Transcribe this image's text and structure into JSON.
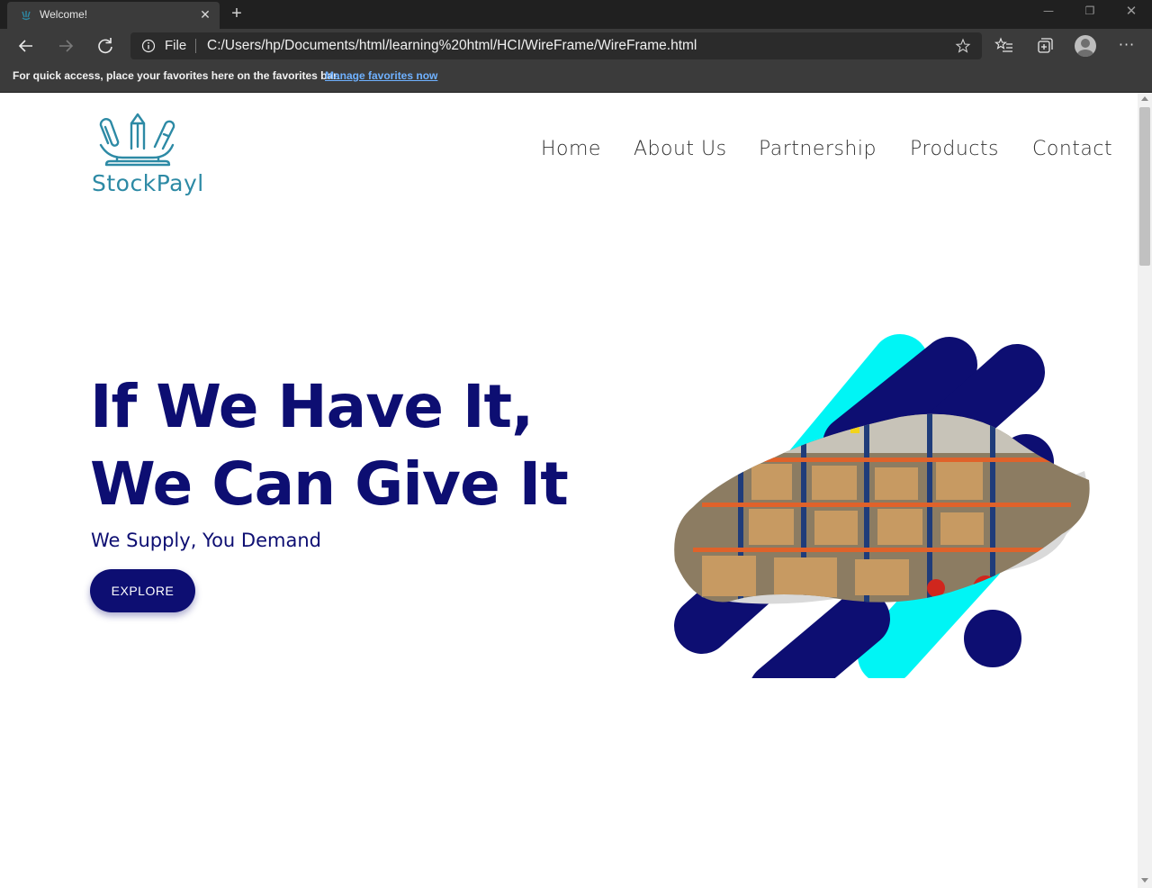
{
  "browser": {
    "tab_title": "Welcome!",
    "address_scheme_label": "File",
    "url": "C:/Users/hp/Documents/html/learning%20html/HCI/WireFrame/WireFrame.html",
    "favorites_bar_text": "For quick access, place your favorites here on the favorites bar.",
    "favorites_bar_link": "Manage favorites now",
    "icons": [
      "favicon",
      "close-icon",
      "plus-icon",
      "minimize-icon",
      "maximize-icon",
      "window-close-icon",
      "back-arrow-icon",
      "forward-arrow-icon",
      "reload-icon",
      "info-icon",
      "star-icon",
      "favorites-list-icon",
      "collections-icon",
      "profile-avatar",
      "more-icon"
    ]
  },
  "site": {
    "logo_text": "StockPayl",
    "nav": {
      "home": "Home",
      "about": "About Us",
      "partnership": "Partnership",
      "products": "Products",
      "contact": "Contact"
    },
    "hero": {
      "line1": "If We Have It,",
      "line2": "We Can Give It",
      "subtitle": "We Supply, You Demand",
      "cta": "EXPLORE"
    }
  },
  "colors": {
    "brand_navy": "#0d0e72",
    "accent_cyan": "#00f5f5",
    "logo_teal": "#2d8aa5",
    "chrome_dark": "#3b3b3b"
  }
}
